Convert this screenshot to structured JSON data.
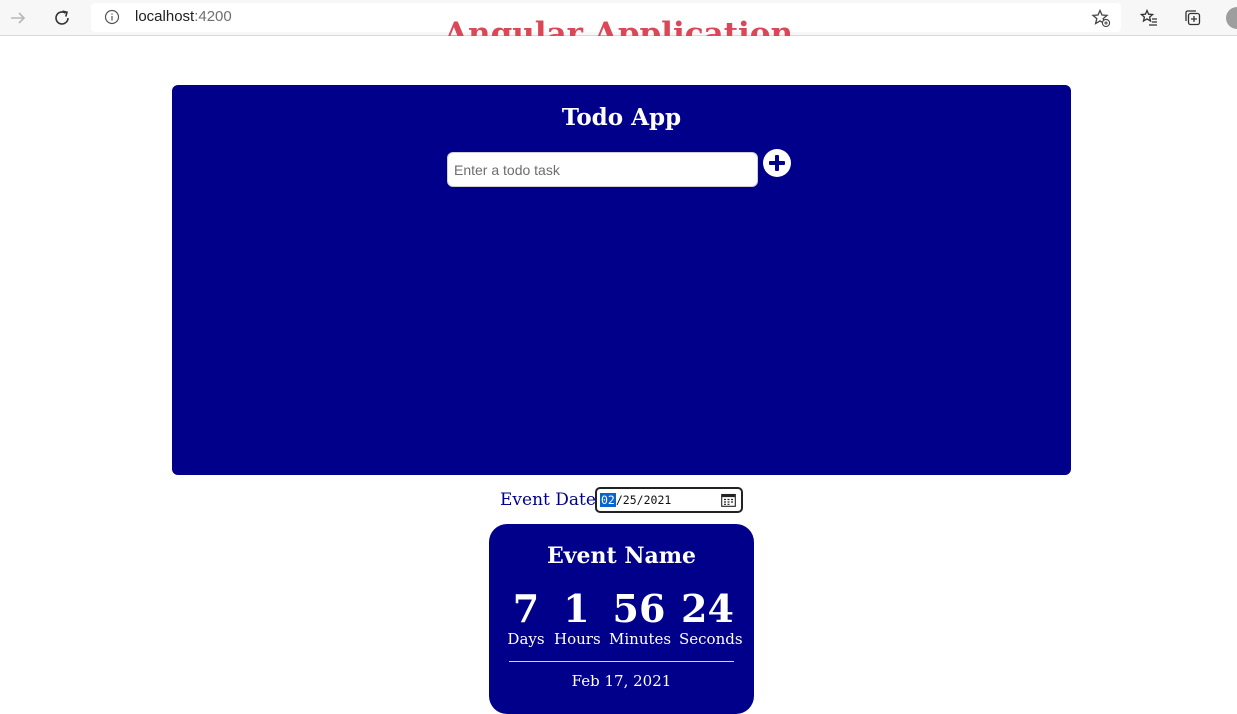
{
  "browser": {
    "url_host": "localhost",
    "url_port": ":4200"
  },
  "page": {
    "title": "Angular Application"
  },
  "todo": {
    "title": "Todo App",
    "input_placeholder": "Enter a todo task",
    "input_value": ""
  },
  "event_date": {
    "label": "Event Date:",
    "month": "02",
    "day": "25",
    "year": "2021",
    "separator": "/"
  },
  "event": {
    "name": "Event Name",
    "countdown": {
      "days_value": "7",
      "days_label": "Days",
      "hours_value": "1",
      "hours_label": "Hours",
      "minutes_value": "56",
      "minutes_label": "Minutes",
      "seconds_value": "24",
      "seconds_label": "Seconds"
    },
    "date": "Feb 17, 2021"
  },
  "colors": {
    "panel": "#00008b",
    "title": "#dc4758",
    "date_selection": "#0a64d0"
  },
  "icons": [
    "forward-arrow-icon",
    "reload-icon",
    "info-icon",
    "add-favorite-icon",
    "favorites-icon",
    "collections-icon",
    "plus-icon",
    "calendar-icon"
  ]
}
